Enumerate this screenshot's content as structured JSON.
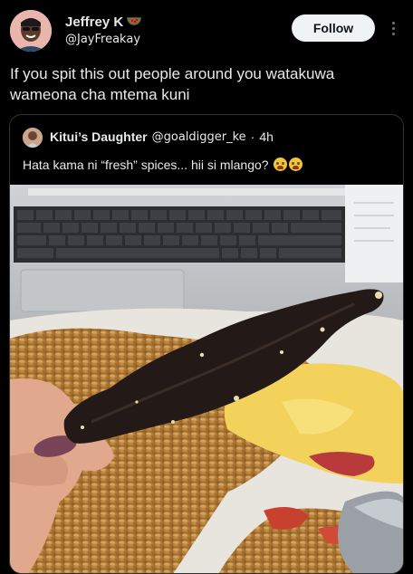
{
  "author": {
    "name": "Jeffrey K",
    "handle": "@JayFreakay",
    "name_emoji": "watermelon-icon"
  },
  "follow_label": "Follow",
  "tweet_text": "If you spit this out people around you watakuwa wameona cha mtema kuni",
  "quoted": {
    "name": "Kitui’s Daughter",
    "handle": "@goaldigger_ke",
    "separator": "·",
    "time": "4h",
    "text": "Hata kama ni “fresh” spices... hii si mlango?",
    "emojis": [
      "crying-face-icon",
      "crying-face-icon"
    ]
  },
  "colors": {
    "background": "#000000",
    "text": "#e7e9ea",
    "follow_bg": "#eff3f4",
    "border": "#2f3336"
  }
}
